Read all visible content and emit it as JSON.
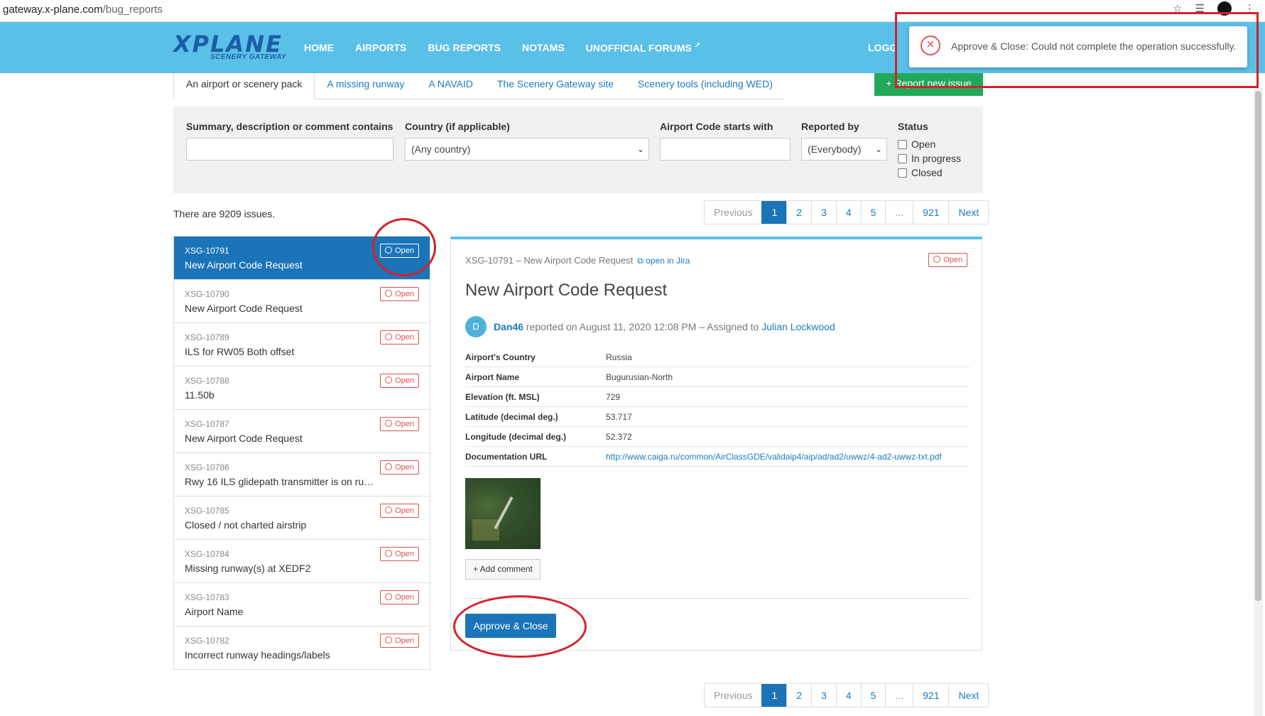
{
  "browser": {
    "url_host": "gateway.x-plane.com",
    "url_path": "/bug_reports"
  },
  "header": {
    "logo_main": "XPLANE",
    "logo_sub": "SCENERY GATEWAY",
    "nav": [
      "HOME",
      "AIRPORTS",
      "BUG REPORTS",
      "NOTAMS",
      "UNOFFICIAL FORUMS"
    ],
    "logged": "LOGG"
  },
  "category_tabs": [
    "An airport or scenery pack",
    "A missing runway",
    "A NAVAID",
    "The Scenery Gateway site",
    "Scenery tools (including WED)"
  ],
  "report_button": "+ Report new issue",
  "filters": {
    "summary_label": "Summary, description or comment contains",
    "summary_value": "",
    "country_label": "Country (if applicable)",
    "country_value": "(Any country)",
    "airport_code_label": "Airport Code starts with",
    "airport_code_value": "",
    "reported_by_label": "Reported by",
    "reported_by_value": "(Everybody)",
    "status_label": "Status",
    "status_options": [
      "Open",
      "In progress",
      "Closed"
    ]
  },
  "issue_count_text": "There are 9209 issues.",
  "pagination": [
    "Previous",
    "1",
    "2",
    "3",
    "4",
    "5",
    "...",
    "921",
    "Next"
  ],
  "issues": [
    {
      "id": "XSG-10791",
      "title": "New Airport Code Request",
      "status": "Open"
    },
    {
      "id": "XSG-10790",
      "title": "New Airport Code Request",
      "status": "Open"
    },
    {
      "id": "XSG-10789",
      "title": "ILS for RW05 Both offset",
      "status": "Open"
    },
    {
      "id": "XSG-10788",
      "title": "11.50b",
      "status": "Open"
    },
    {
      "id": "XSG-10787",
      "title": "New Airport Code Request",
      "status": "Open"
    },
    {
      "id": "XSG-10786",
      "title": "Rwy 16 ILS glidepath transmitter is on run...",
      "status": "Open"
    },
    {
      "id": "XSG-10785",
      "title": "Closed / not charted airstrip",
      "status": "Open"
    },
    {
      "id": "XSG-10784",
      "title": "Missing runway(s) at XEDF2",
      "status": "Open"
    },
    {
      "id": "XSG-10783",
      "title": "Airport Name",
      "status": "Open"
    },
    {
      "id": "XSG-10782",
      "title": "Incorrect runway headings/labels",
      "status": "Open"
    }
  ],
  "detail": {
    "id_line": "XSG-10791 – New Airport Code Request",
    "jira_link": "open in Jira",
    "status": "Open",
    "title": "New Airport Code Request",
    "avatar_letter": "D",
    "reporter": "Dan46",
    "reported_text": " reported on August 11, 2020 12:08 PM – Assigned to ",
    "assignee": "Julian Lockwood",
    "fields": [
      {
        "key": "Airport's Country",
        "value": "Russia"
      },
      {
        "key": "Airport Name",
        "value": "Bugurusian-North"
      },
      {
        "key": "Elevation (ft. MSL)",
        "value": "729"
      },
      {
        "key": "Latitude (decimal deg.)",
        "value": "53.717"
      },
      {
        "key": "Longitude (decimal deg.)",
        "value": "52.372"
      },
      {
        "key": "Documentation URL",
        "value": "http://www.caiga.ru/common/AirClassGDE/validaip4/aip/ad/ad2/uwwz/4-ad2-uwwz-txt.pdf"
      }
    ],
    "add_comment": "+ Add comment",
    "approve_button": "Approve & Close"
  },
  "toast": {
    "message": "Approve & Close: Could not complete the operation successfully."
  },
  "colors": {
    "header_bg": "#5bc0e8",
    "primary": "#1a74b7",
    "link": "#1a7bc0",
    "open_badge": "#d9534f",
    "report_btn": "#21a85a",
    "annotation": "#d8202a"
  }
}
